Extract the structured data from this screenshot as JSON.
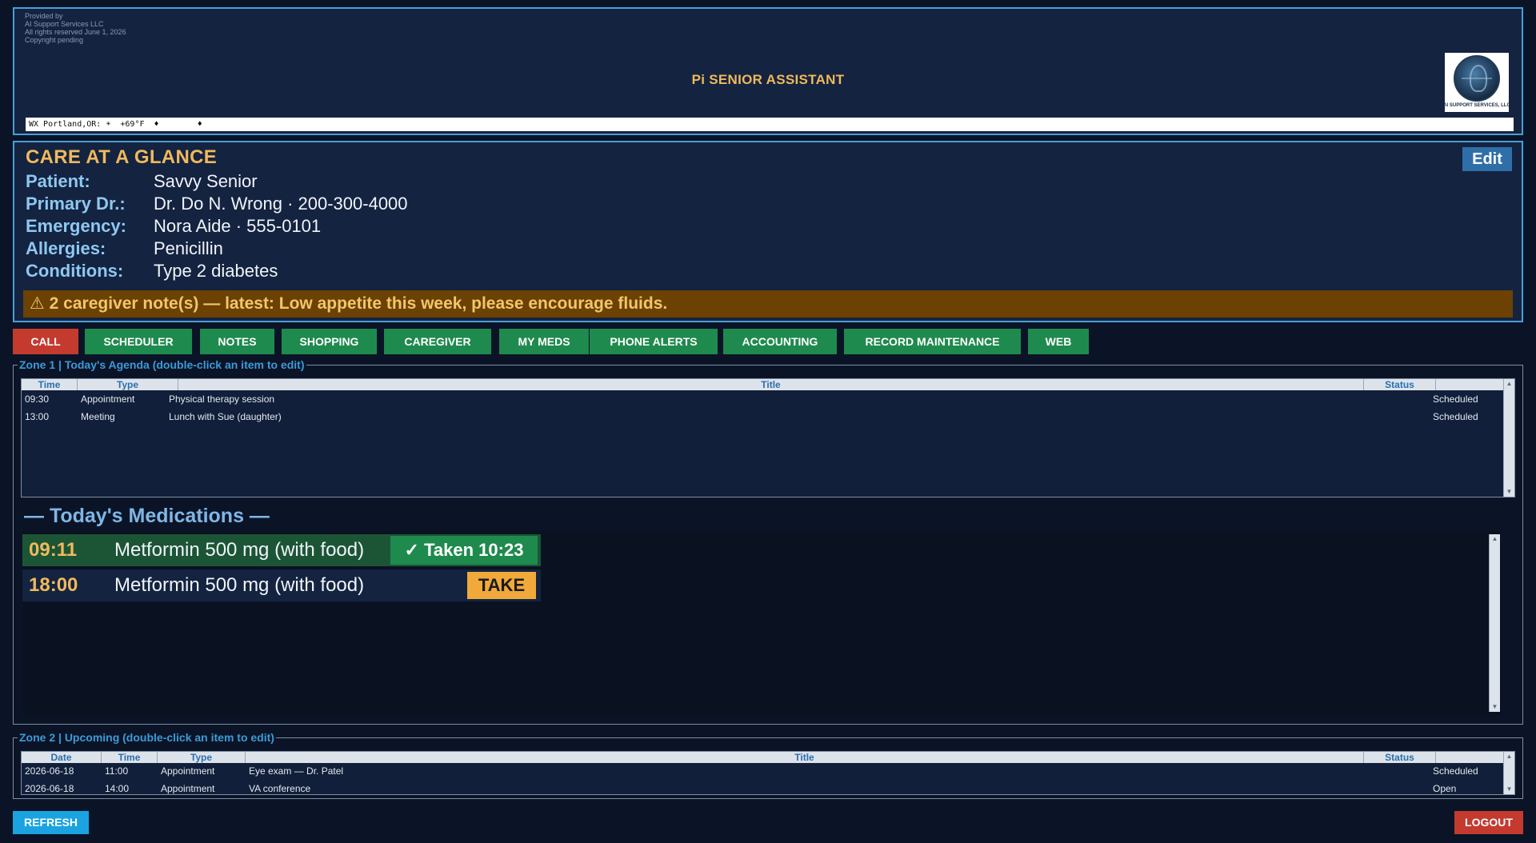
{
  "header": {
    "provided_lines": [
      "Provided by",
      "AI Support Services LLC",
      "All rights reserved  June 1, 2026",
      "Copyright pending"
    ],
    "title": "Pi SENIOR ASSISTANT",
    "logo_text": "AI SUPPORT SERVICES, LLC",
    "ticker": "WX Portland,OR: ☀  +69°F  ♦        ♦"
  },
  "glance": {
    "title": "CARE AT A GLANCE",
    "edit_label": "Edit",
    "rows": [
      {
        "label": "Patient:",
        "value": "Savvy Senior"
      },
      {
        "label": "Primary Dr.:",
        "value": "Dr. Do N. Wrong · 200-300-4000"
      },
      {
        "label": "Emergency:",
        "value": "Nora Aide · 555-0101"
      },
      {
        "label": "Allergies:",
        "value": "Penicillin"
      },
      {
        "label": "Conditions:",
        "value": "Type 2 diabetes"
      }
    ],
    "note_banner": "⚠ 2 caregiver note(s) — latest: Low appetite this week, please encourage fluids."
  },
  "nav": {
    "buttons": [
      "CALL",
      "SCHEDULER",
      "NOTES",
      "SHOPPING",
      "CAREGIVER",
      "MY MEDS",
      "PHONE ALERTS",
      "ACCOUNTING",
      "RECORD MAINTENANCE",
      "WEB"
    ]
  },
  "zone1": {
    "legend": "Zone 1 | Today's Agenda  (double-click an item to edit)",
    "columns": [
      "Time",
      "Type",
      "Title",
      "Status"
    ],
    "rows": [
      {
        "time": "09:30",
        "type": "Appointment",
        "title": "Physical therapy session",
        "status": "Scheduled"
      },
      {
        "time": "13:00",
        "type": "Meeting",
        "title": "Lunch with Sue (daughter)",
        "status": "Scheduled"
      }
    ]
  },
  "meds": {
    "title": "— Today's Medications —",
    "rows": [
      {
        "time": "09:11",
        "name": "Metformin 500 mg  (with food)",
        "action": "✓ Taken 10:23",
        "taken": true
      },
      {
        "time": "18:00",
        "name": "Metformin 500 mg  (with food)",
        "action": "TAKE",
        "taken": false
      }
    ]
  },
  "zone2": {
    "legend": "Zone 2 | Upcoming  (double-click an item to edit)",
    "columns": [
      "Date",
      "Time",
      "Type",
      "Title",
      "Status"
    ],
    "rows": [
      {
        "date": "2026-06-18",
        "time": "11:00",
        "type": "Appointment",
        "title": "Eye exam — Dr. Patel",
        "status": "Scheduled"
      },
      {
        "date": "2026-06-18",
        "time": "14:00",
        "type": "Appointment",
        "title": "VA conference",
        "status": "Open"
      }
    ]
  },
  "footer": {
    "refresh_label": "REFRESH",
    "logout_label": "LOGOUT"
  },
  "colors": {
    "background": "#0b1426",
    "panel": "#142340",
    "accent_gold": "#f0b95c",
    "border_blue": "#4a9fd8",
    "button_green": "#1f8a4e",
    "button_red": "#c43a2f",
    "take_orange": "#f0a93a"
  }
}
